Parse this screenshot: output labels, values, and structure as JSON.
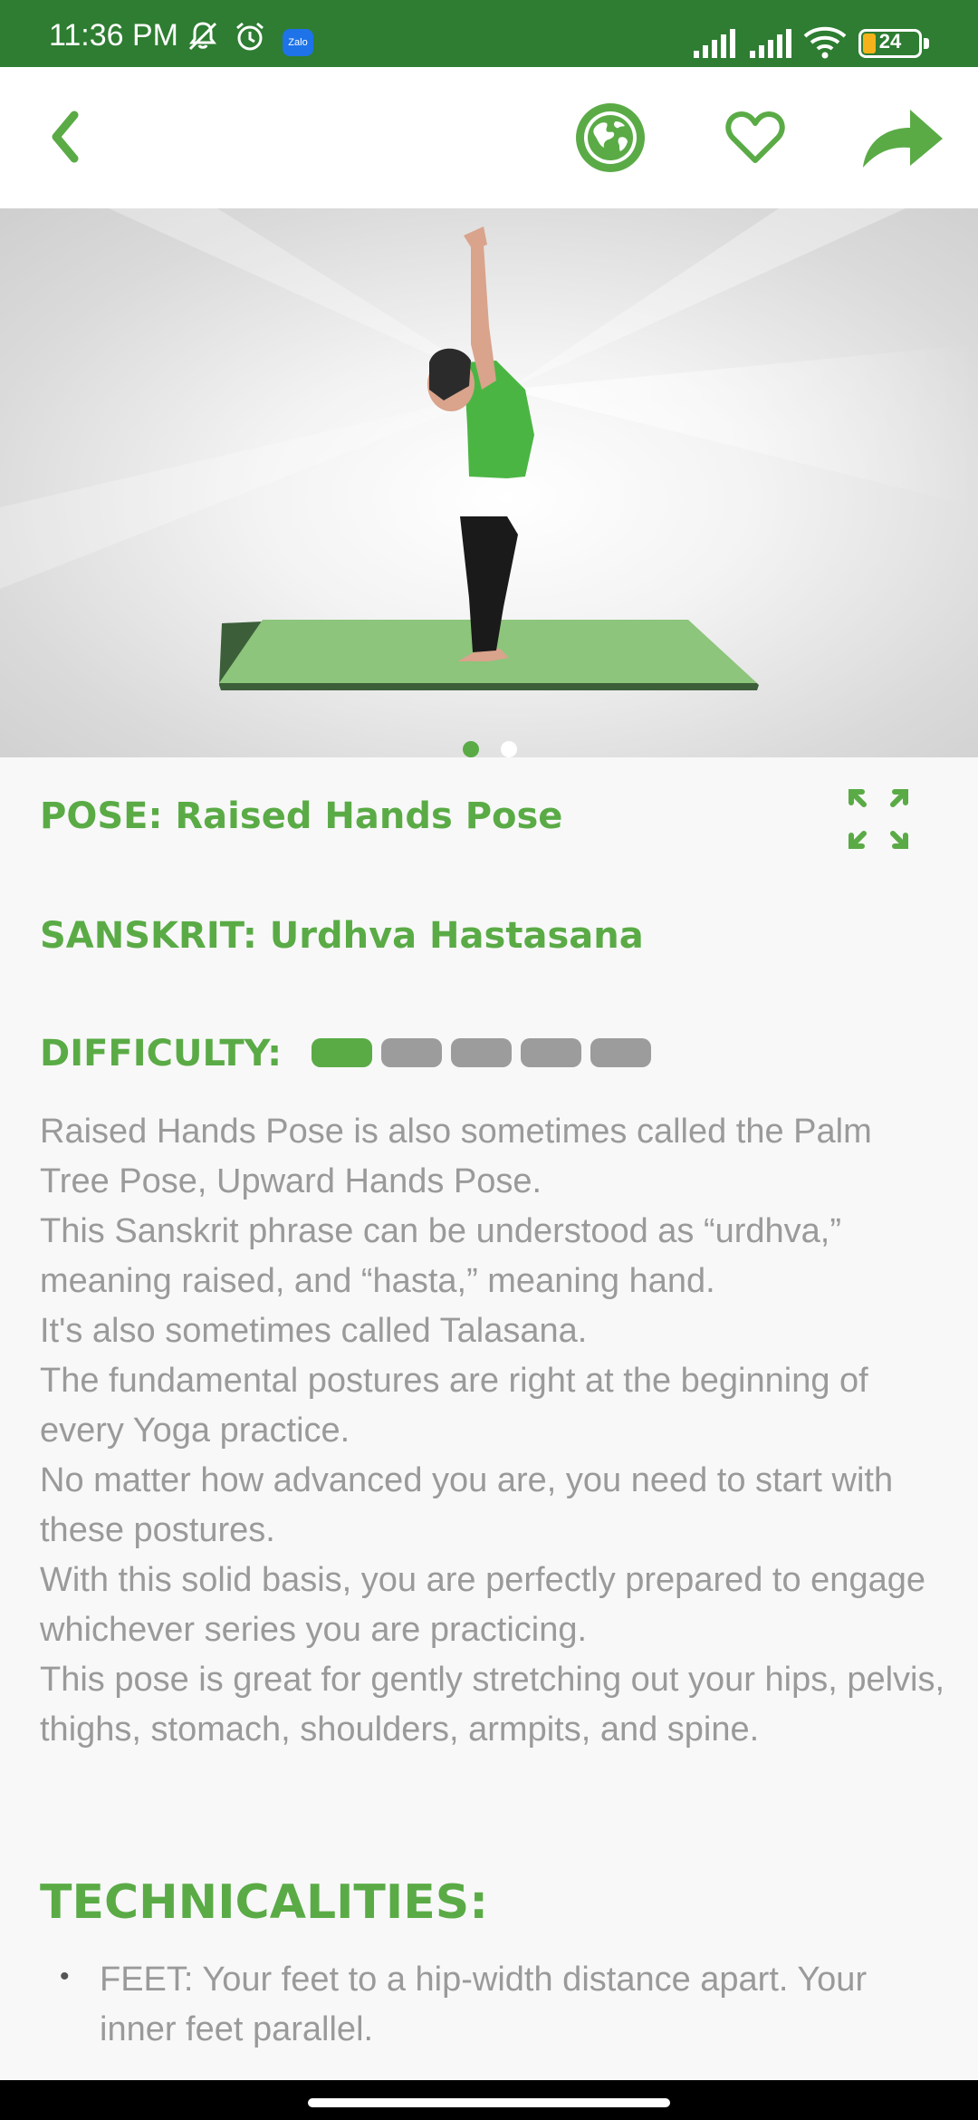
{
  "status_bar": {
    "time": "11:36 PM",
    "notification_icon": "Zalo",
    "battery_percent": "24",
    "battery_level": 0.24,
    "background_color": "#2e7d32"
  },
  "toolbar": {
    "back_icon": "chevron-left-icon",
    "language_icon": "globe-icon",
    "favorite_icon": "heart-icon",
    "share_icon": "share-arrow-icon",
    "accent_color": "#5aab46"
  },
  "carousel": {
    "page_count": 2,
    "active_index": 0
  },
  "pose": {
    "title": "POSE: Raised Hands Pose",
    "sanskrit": "SANSKRIT: Urdhva Hastasana",
    "difficulty_label": "DIFFICULTY:",
    "difficulty_level": 1,
    "difficulty_max": 5
  },
  "description": [
    "Raised Hands Pose is also sometimes called the Palm Tree Pose,  Upward Hands Pose.",
    "This Sanskrit phrase can be understood as “urdhva,” meaning raised, and “hasta,” meaning hand.",
    "It's also sometimes called Talasana.",
    "The fundamental postures are right at the beginning of every Yoga practice.",
    "No matter how advanced you are, you need to start with these postures.",
    "With this solid basis, you are perfectly prepared to engage whichever series you are practicing.",
    "This pose is great for gently stretching out your hips, pelvis, thighs, stomach, shoulders, armpits, and spine."
  ],
  "technicalities": {
    "heading": "TECHNICALITIES:",
    "items": [
      "FEET: Your feet to a hip-width distance apart. Your inner feet parallel."
    ]
  }
}
